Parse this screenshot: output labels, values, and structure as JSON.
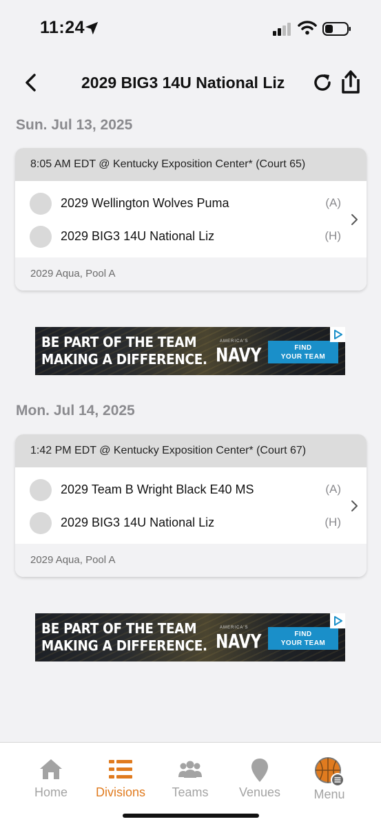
{
  "status_bar": {
    "time": "11:24"
  },
  "header": {
    "title": "2029 BIG3 14U National Liz"
  },
  "days": [
    {
      "date": "Sun. Jul 13, 2025",
      "game": {
        "info": "8:05 AM EDT @ Kentucky Exposition Center* (Court 65)",
        "teams": [
          {
            "name": "2029 Wellington Wolves Puma",
            "side": "(A)"
          },
          {
            "name": "2029 BIG3 14U National Liz",
            "side": "(H)"
          }
        ],
        "pool": "2029 Aqua, Pool A"
      }
    },
    {
      "date": "Mon. Jul 14, 2025",
      "game": {
        "info": "1:42 PM EDT @ Kentucky Exposition Center* (Court 67)",
        "teams": [
          {
            "name": "2029 Team B Wright Black E40 MS",
            "side": "(A)"
          },
          {
            "name": "2029 BIG3 14U National Liz",
            "side": "(H)"
          }
        ],
        "pool": "2029 Aqua, Pool A"
      }
    }
  ],
  "ad": {
    "line1": "BE PART OF THE TEAM",
    "line2": "MAKING A DIFFERENCE.",
    "brand_small": "AMERICA'S",
    "brand": "NAVY",
    "cta_line1": "FIND",
    "cta_line2": "YOUR TEAM"
  },
  "tabs": [
    {
      "label": "Home",
      "icon": "home-icon",
      "active": false
    },
    {
      "label": "Divisions",
      "icon": "divisions-icon",
      "active": true
    },
    {
      "label": "Teams",
      "icon": "teams-icon",
      "active": false
    },
    {
      "label": "Venues",
      "icon": "venues-icon",
      "active": false
    },
    {
      "label": "Menu",
      "icon": "menu-basketball-icon",
      "active": false
    }
  ],
  "colors": {
    "accent": "#e07b1f",
    "inactive": "#a3a3a3",
    "background": "#f2f2f4"
  }
}
